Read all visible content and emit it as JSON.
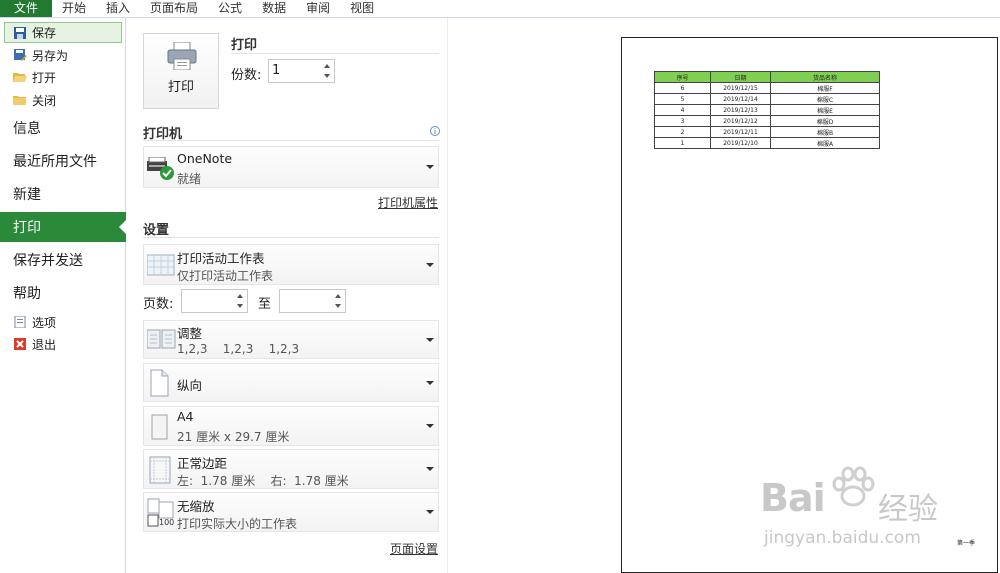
{
  "ribbon": {
    "tabs": [
      "文件",
      "开始",
      "插入",
      "页面布局",
      "公式",
      "数据",
      "审阅",
      "视图"
    ]
  },
  "sidebar": {
    "save": "保存",
    "save_as": "另存为",
    "open": "打开",
    "close": "关闭",
    "info": "信息",
    "recent": "最近所用文件",
    "new": "新建",
    "print": "打印",
    "save_send": "保存并发送",
    "help": "帮助",
    "options": "选项",
    "exit": "退出"
  },
  "print": {
    "button_label": "打印",
    "heading": "打印",
    "copies_label": "份数:",
    "copies_value": "1",
    "printer_heading": "打印机",
    "printer_name": "OneNote",
    "printer_status": "就绪",
    "printer_props": "打印机属性",
    "settings_heading": "设置",
    "what_title": "打印活动工作表",
    "what_sub": "仅打印活动工作表",
    "pages_label": "页数:",
    "pages_to": "至",
    "collate_title": "调整",
    "collate_sub": "1,2,3    1,2,3    1,2,3",
    "orientation": "纵向",
    "paper_title": "A4",
    "paper_sub": "21 厘米 x 29.7 厘米",
    "margins_title": "正常边距",
    "margins_sub": "左:  1.78 厘米    右:  1.78 厘米",
    "scaling_title": "无缩放",
    "scaling_sub": "打印实际大小的工作表",
    "page_setup": "页面设置"
  },
  "preview": {
    "headers": [
      "序号",
      "日期",
      "货品名称"
    ],
    "rows": [
      [
        "6",
        "2019/12/15",
        "棉服F"
      ],
      [
        "5",
        "2019/12/14",
        "棉服C"
      ],
      [
        "4",
        "2019/12/13",
        "棉服E"
      ],
      [
        "3",
        "2019/12/12",
        "棉服D"
      ],
      [
        "2",
        "2019/12/11",
        "棉服B"
      ],
      [
        "1",
        "2019/12/10",
        "棉服A"
      ]
    ],
    "footer": "第一季",
    "header_color": "#7fcf52"
  },
  "watermark": {
    "brand": "Bai",
    "brand2": "经验",
    "url": "jingyan.baidu.com"
  },
  "colors": {
    "accent": "#217a30",
    "selected": "#2a8a3a"
  }
}
